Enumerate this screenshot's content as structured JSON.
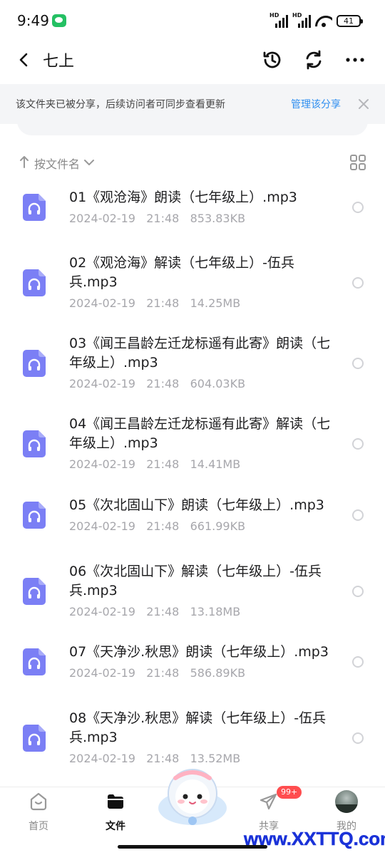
{
  "status_bar": {
    "time": "9:49",
    "hd_label": "HD",
    "battery": "41"
  },
  "header": {
    "title": "七上"
  },
  "share_banner": {
    "text": "该文件夹已被分享，后续访问者可同步查看更新",
    "link": "管理该分享"
  },
  "sort": {
    "label": "按文件名"
  },
  "files": [
    {
      "name": "01《观沧海》朗读（七年级上）.mp3",
      "date": "2024-02-19",
      "time": "21:48",
      "size": "853.83KB"
    },
    {
      "name": "02《观沧海》解读（七年级上）-伍兵兵.mp3",
      "date": "2024-02-19",
      "time": "21:48",
      "size": "14.25MB"
    },
    {
      "name": "03《闻王昌龄左迁龙标遥有此寄》朗读（七年级上）.mp3",
      "date": "2024-02-19",
      "time": "21:48",
      "size": "604.03KB"
    },
    {
      "name": "04《闻王昌龄左迁龙标遥有此寄》解读（七年级上）.mp3",
      "date": "2024-02-19",
      "time": "21:48",
      "size": "14.41MB"
    },
    {
      "name": "05《次北固山下》朗读（七年级上）.mp3",
      "date": "2024-02-19",
      "time": "21:48",
      "size": "661.99KB"
    },
    {
      "name": "06《次北固山下》解读（七年级上）-伍兵兵.mp3",
      "date": "2024-02-19",
      "time": "21:48",
      "size": "13.18MB"
    },
    {
      "name": "07《天净沙.秋思》朗读（七年级上）.mp3",
      "date": "2024-02-19",
      "time": "21:48",
      "size": "586.89KB"
    },
    {
      "name": "08《天净沙.秋思》解读（七年级上）-伍兵兵.mp3",
      "date": "2024-02-19",
      "time": "21:48",
      "size": "13.52MB"
    }
  ],
  "tabs": {
    "home": "首页",
    "files": "文件",
    "share": "共享",
    "me": "我的",
    "share_badge": "99+"
  },
  "watermark": "www.XXTTQ.com",
  "colors": {
    "accent": "#2f8ff0",
    "file_icon": "#7b7ff5",
    "badge": "#ff4d4f",
    "watermark": "#1a32d8"
  }
}
